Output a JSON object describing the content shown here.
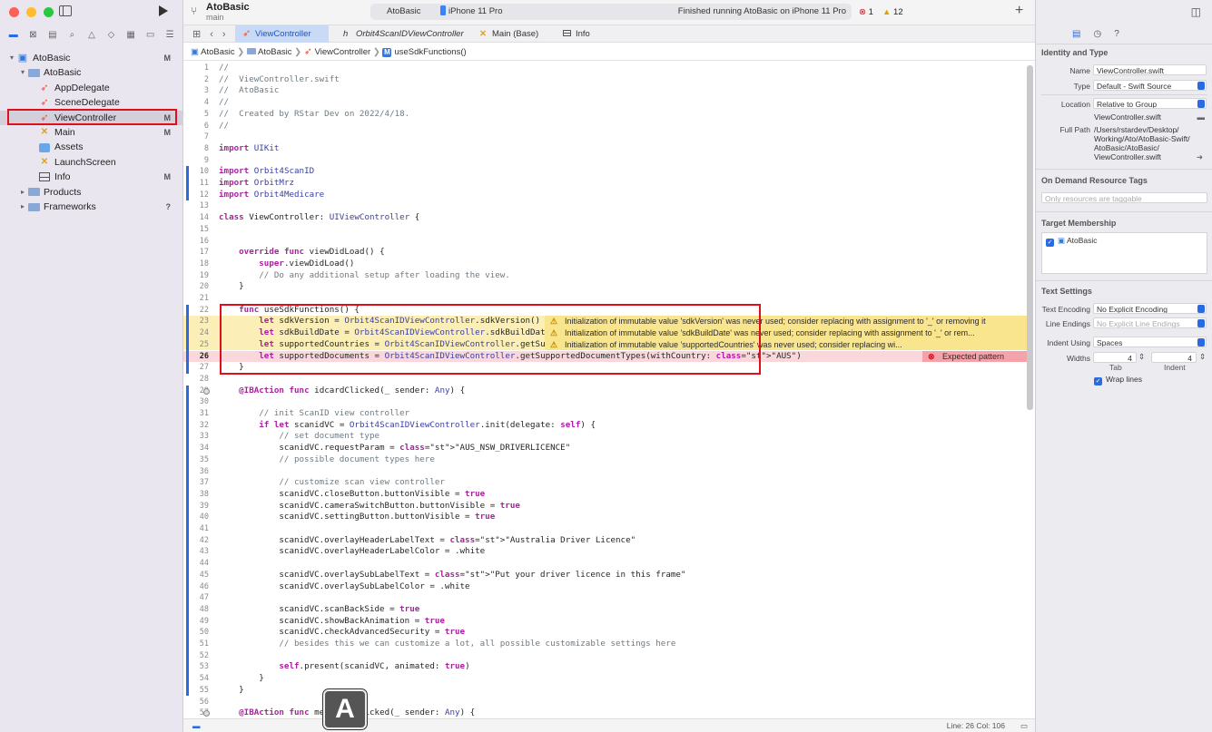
{
  "project": {
    "name": "AtoBasic",
    "branch": "main"
  },
  "scheme": {
    "target": "AtoBasic",
    "device": "iPhone 11 Pro",
    "status": "Finished running AtoBasic on iPhone 11 Pro",
    "errors": "1",
    "warnings": "12"
  },
  "navigator": [
    {
      "label": "AtoBasic",
      "level": 0,
      "icon": "project-icon",
      "disclosure": "▾",
      "badge": "M"
    },
    {
      "label": "AtoBasic",
      "level": 1,
      "icon": "folder-icon",
      "disclosure": "▾",
      "badge": ""
    },
    {
      "label": "AppDelegate",
      "level": 2,
      "icon": "swift-file-icon",
      "disclosure": "",
      "badge": ""
    },
    {
      "label": "SceneDelegate",
      "level": 2,
      "icon": "swift-file-icon",
      "disclosure": "",
      "badge": ""
    },
    {
      "label": "ViewController",
      "level": 2,
      "icon": "swift-file-icon",
      "disclosure": "",
      "badge": "M",
      "selected": true
    },
    {
      "label": "Main",
      "level": 2,
      "icon": "storyboard-icon",
      "disclosure": "",
      "badge": "M"
    },
    {
      "label": "Assets",
      "level": 2,
      "icon": "assets-icon",
      "disclosure": "",
      "badge": ""
    },
    {
      "label": "LaunchScreen",
      "level": 2,
      "icon": "storyboard-icon",
      "disclosure": "",
      "badge": ""
    },
    {
      "label": "Info",
      "level": 2,
      "icon": "plist-icon",
      "disclosure": "",
      "badge": "M"
    },
    {
      "label": "Products",
      "level": 1,
      "icon": "folder-icon",
      "disclosure": "▸",
      "badge": ""
    },
    {
      "label": "Frameworks",
      "level": 1,
      "icon": "folder-icon",
      "disclosure": "▸",
      "badge": "?"
    }
  ],
  "tabs": [
    {
      "label": "ViewController",
      "active": true
    },
    {
      "label": "Orbit4ScanIDViewController",
      "active": false
    },
    {
      "label": "Main (Base)",
      "active": false
    },
    {
      "label": "Info",
      "active": false
    }
  ],
  "breadcrumb": [
    "AtoBasic",
    "AtoBasic",
    "ViewController",
    "useSdkFunctions()"
  ],
  "code_lines": [
    {
      "n": "1",
      "t": "//"
    },
    {
      "n": "2",
      "t": "//  ViewController.swift"
    },
    {
      "n": "3",
      "t": "//  AtoBasic"
    },
    {
      "n": "4",
      "t": "//"
    },
    {
      "n": "5",
      "t": "//  Created by RStar Dev on 2022/4/18."
    },
    {
      "n": "6",
      "t": "//"
    },
    {
      "n": "7",
      "t": ""
    },
    {
      "n": "8",
      "t": "import UIKit"
    },
    {
      "n": "9",
      "t": ""
    },
    {
      "n": "10",
      "t": "import Orbit4ScanID"
    },
    {
      "n": "11",
      "t": "import OrbitMrz"
    },
    {
      "n": "12",
      "t": "import Orbit4Medicare"
    },
    {
      "n": "13",
      "t": ""
    },
    {
      "n": "14",
      "t": "class ViewController: UIViewController {"
    },
    {
      "n": "15",
      "t": ""
    },
    {
      "n": "16",
      "t": ""
    },
    {
      "n": "17",
      "t": "    override func viewDidLoad() {"
    },
    {
      "n": "18",
      "t": "        super.viewDidLoad()"
    },
    {
      "n": "19",
      "t": "        // Do any additional setup after loading the view."
    },
    {
      "n": "20",
      "t": "    }"
    },
    {
      "n": "21",
      "t": ""
    },
    {
      "n": "22",
      "t": "    func useSdkFunctions() {"
    },
    {
      "n": "23",
      "t": "        let sdkVersion = Orbit4ScanIDViewController.sdkVersion()"
    },
    {
      "n": "24",
      "t": "        let sdkBuildDate = Orbit4ScanIDViewController.sdkBuildDate()"
    },
    {
      "n": "25",
      "t": "        let supportedCountries = Orbit4ScanIDViewController.getSupportedCountries()"
    },
    {
      "n": "26",
      "t": "        let supportedDocuments = Orbit4ScanIDViewController.getSupportedDocumentTypes(withCountry: \"AUS\")"
    },
    {
      "n": "27",
      "t": "    }"
    },
    {
      "n": "28",
      "t": ""
    },
    {
      "n": "29",
      "t": "    @IBAction func idcardClicked(_ sender: Any) {"
    },
    {
      "n": "30",
      "t": ""
    },
    {
      "n": "31",
      "t": "        // init ScanID view controller"
    },
    {
      "n": "32",
      "t": "        if let scanidVC = Orbit4ScanIDViewController.init(delegate: self) {"
    },
    {
      "n": "33",
      "t": "            // set document type"
    },
    {
      "n": "34",
      "t": "            scanidVC.requestParam = \"AUS_NSW_DRIVERLICENCE\""
    },
    {
      "n": "35",
      "t": "            // possible document types here"
    },
    {
      "n": "36",
      "t": ""
    },
    {
      "n": "37",
      "t": "            // customize scan view controller"
    },
    {
      "n": "38",
      "t": "            scanidVC.closeButton.buttonVisible = true"
    },
    {
      "n": "39",
      "t": "            scanidVC.cameraSwitchButton.buttonVisible = true"
    },
    {
      "n": "40",
      "t": "            scanidVC.settingButton.buttonVisible = true"
    },
    {
      "n": "41",
      "t": ""
    },
    {
      "n": "42",
      "t": "            scanidVC.overlayHeaderLabelText = \"Australia Driver Licence\""
    },
    {
      "n": "43",
      "t": "            scanidVC.overlayHeaderLabelColor = .white"
    },
    {
      "n": "44",
      "t": ""
    },
    {
      "n": "45",
      "t": "            scanidVC.overlaySubLabelText = \"Put your driver licence in this frame\""
    },
    {
      "n": "46",
      "t": "            scanidVC.overlaySubLabelColor = .white"
    },
    {
      "n": "47",
      "t": ""
    },
    {
      "n": "48",
      "t": "            scanidVC.scanBackSide = true"
    },
    {
      "n": "49",
      "t": "            scanidVC.showBackAnimation = true"
    },
    {
      "n": "50",
      "t": "            scanidVC.checkAdvancedSecurity = true"
    },
    {
      "n": "51",
      "t": "            // besides this we can customize a lot, all possible customizable settings here"
    },
    {
      "n": "52",
      "t": ""
    },
    {
      "n": "53",
      "t": "            self.present(scanidVC, animated: true)"
    },
    {
      "n": "54",
      "t": "        }"
    },
    {
      "n": "55",
      "t": "    }"
    },
    {
      "n": "56",
      "t": ""
    },
    {
      "n": "57",
      "t": "    @IBAction func medicareClicked(_ sender: Any) {"
    }
  ],
  "issues": [
    {
      "line": "23",
      "kind": "warn",
      "text": "Initialization of immutable value 'sdkVersion' was never used; consider replacing with assignment to '_' or removing it"
    },
    {
      "line": "24",
      "kind": "warn",
      "text": "Initialization of immutable value 'sdkBuildDate' was never used; consider replacing with assignment to '_' or rem..."
    },
    {
      "line": "25",
      "kind": "warn",
      "text": "Initialization of immutable value 'supportedCountries' was never used; consider replacing wi..."
    },
    {
      "line": "26",
      "kind": "err",
      "text": "Expected pattern"
    }
  ],
  "status_bar": {
    "position": "Line: 26  Col: 106"
  },
  "inspector": {
    "identity_title": "Identity and Type",
    "name_label": "Name",
    "name": "ViewController.swift",
    "type_label": "Type",
    "type": "Default - Swift Source",
    "location_label": "Location",
    "location": "Relative to Group",
    "location_file": "ViewController.swift",
    "fullpath_label": "Full Path",
    "fullpath_lines": [
      "/Users/rstardev/Desktop/",
      "Working/Ato/AtoBasic-Swift/",
      "AtoBasic/AtoBasic/",
      "ViewController.swift"
    ],
    "odr_title": "On Demand Resource Tags",
    "odr_placeholder": "Only resources are taggable",
    "target_title": "Target Membership",
    "target_name": "AtoBasic",
    "text_title": "Text Settings",
    "encoding_label": "Text Encoding",
    "encoding": "No Explicit Encoding",
    "endings_label": "Line Endings",
    "endings": "No Explicit Line Endings",
    "indent_label": "Indent Using",
    "indent": "Spaces",
    "widths_label": "Widths",
    "tab_value": "4",
    "indent_value": "4",
    "tab_caption": "Tab",
    "indent_caption": "Indent",
    "wrap_label": "Wrap lines"
  }
}
